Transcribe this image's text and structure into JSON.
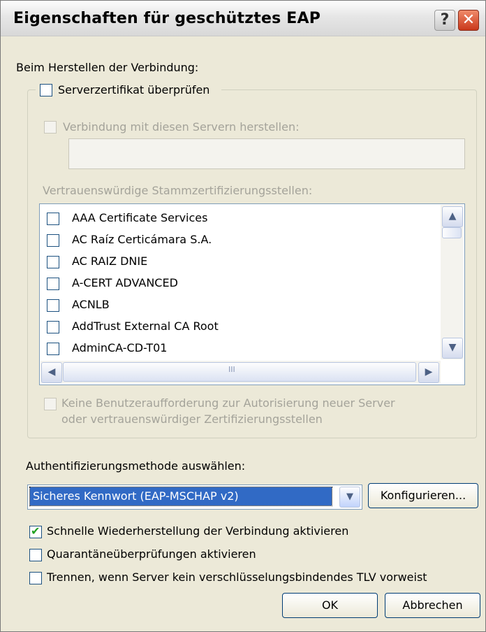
{
  "window": {
    "title": "Eigenschaften für geschütztes EAP",
    "help_glyph": "?",
    "close_glyph": "✕"
  },
  "connection_section": {
    "heading": "Beim Herstellen der Verbindung:",
    "verify_cert_label": "Serverzertifikat überprüfen",
    "connect_servers_label": "Verbindung mit diesen Servern herstellen:",
    "servers_value": "",
    "trusted_roots_label": "Vertrauenswürdige Stammzertifizierungsstellen:",
    "ca_list": [
      "AAA Certificate Services",
      "AC Raíz Certicámara S.A.",
      "AC RAIZ DNIE",
      "A-CERT ADVANCED",
      "ACNLB",
      "AddTrust External CA Root",
      "AdminCA-CD-T01"
    ],
    "scroll_grip": "III",
    "no_prompt_line1": "Keine Benutzeraufforderung zur Autorisierung neuer Server",
    "no_prompt_line2": "oder vertrauenswürdiger Zertifizierungsstellen"
  },
  "auth": {
    "label": "Authentifizierungsmethode auswählen:",
    "selected": "Sicheres Kennwort (EAP-MSCHAP v2)",
    "configure_label": "Konfigurieren..."
  },
  "options": {
    "fast_reconnect": "Schnelle Wiederherstellung der Verbindung aktivieren",
    "quarantine": "Quarantäneüberprüfungen aktivieren",
    "disconnect_tlv": "Trennen, wenn Server kein verschlüsselungsbindendes TLV vorweist"
  },
  "buttons": {
    "ok": "OK",
    "cancel": "Abbrechen"
  }
}
